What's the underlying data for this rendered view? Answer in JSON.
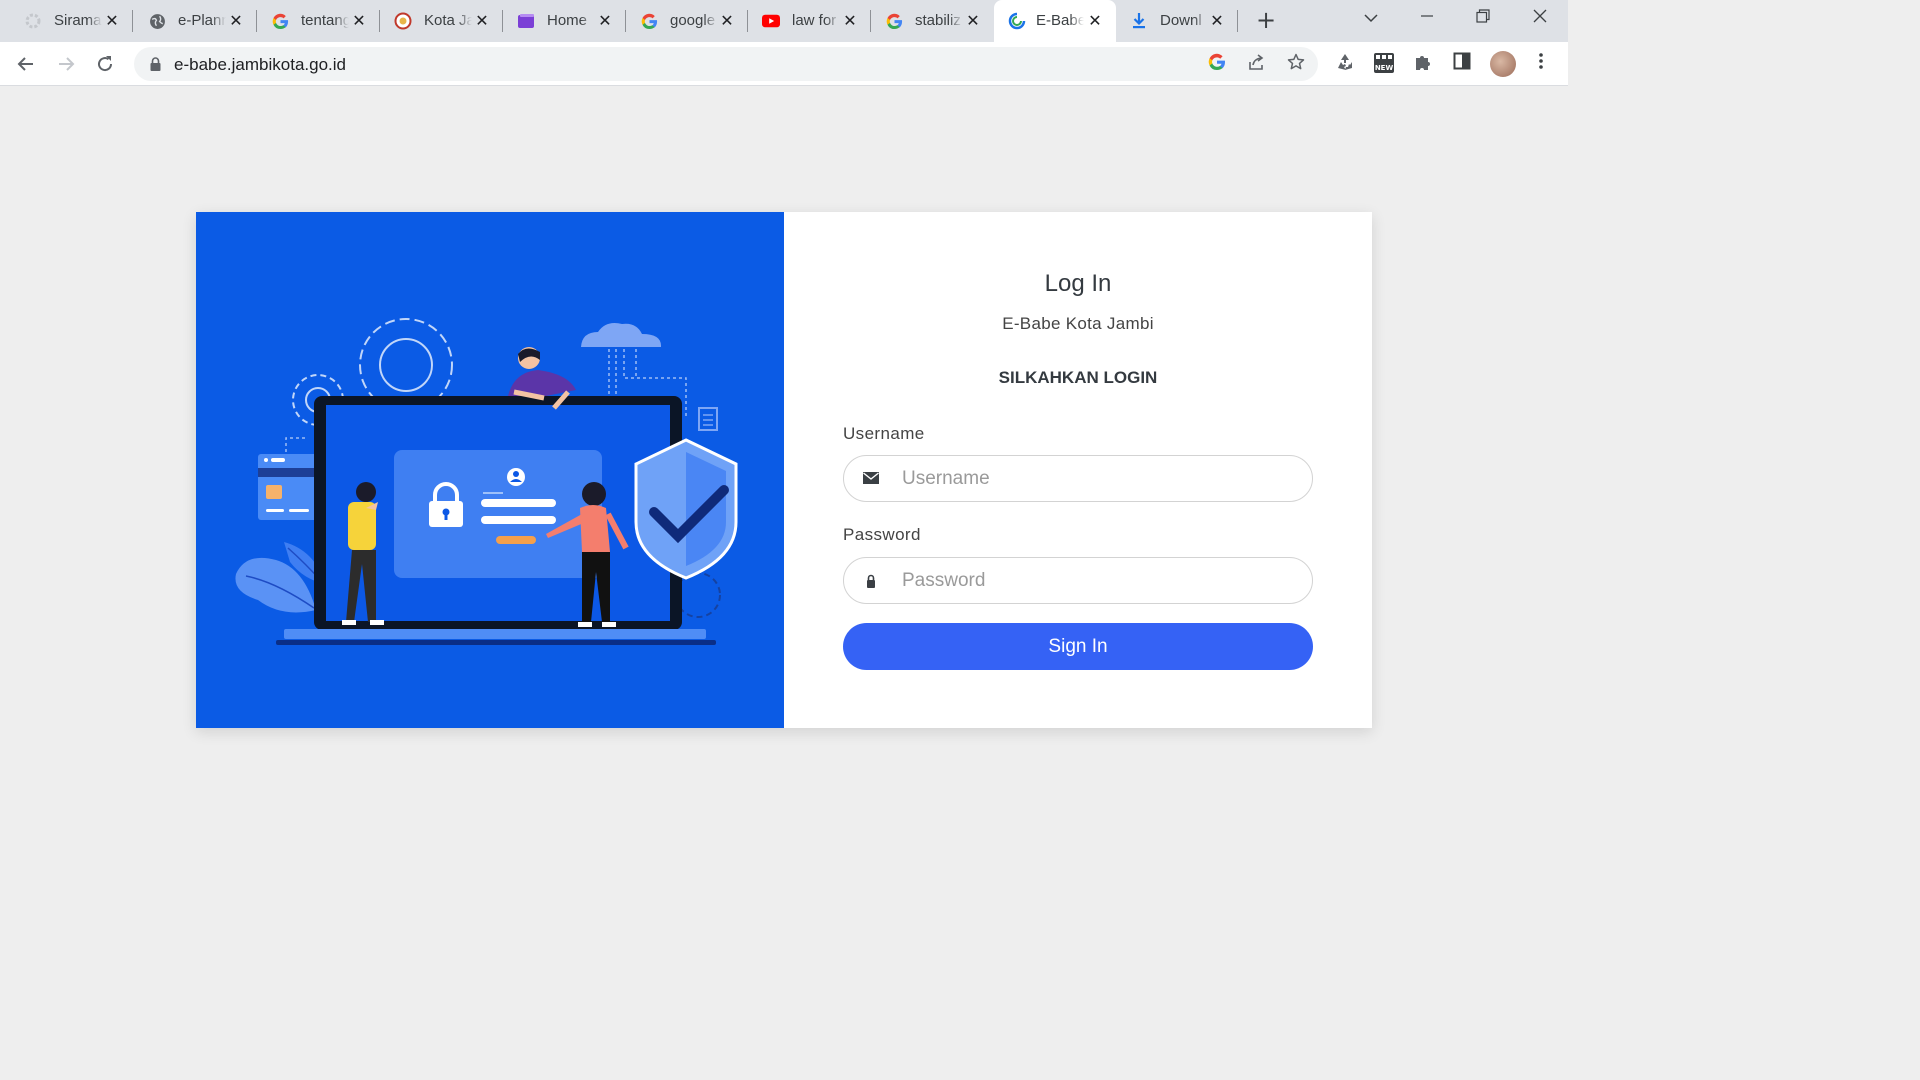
{
  "browser": {
    "tabs": [
      {
        "title": "Sirama",
        "icon": "gear-favicon-icon"
      },
      {
        "title": "e-Planning",
        "icon": "globe-favicon-icon"
      },
      {
        "title": "tentang",
        "icon": "google-favicon-icon"
      },
      {
        "title": "Kota Jambi",
        "icon": "emblem-favicon-icon"
      },
      {
        "title": "Home",
        "icon": "stack-favicon-icon"
      },
      {
        "title": "google",
        "icon": "google-favicon-icon"
      },
      {
        "title": "law for",
        "icon": "youtube-favicon-icon"
      },
      {
        "title": "stabiliz",
        "icon": "google-favicon-icon"
      },
      {
        "title": "E-Babe",
        "icon": "ebabe-favicon-icon",
        "active": true
      },
      {
        "title": "Downl",
        "icon": "download-favicon-icon"
      }
    ],
    "url": "e-babe.jambikota.go.id"
  },
  "colors": {
    "accent": "#3562f5",
    "illustration_bg": "#0b5be5"
  },
  "login": {
    "heading": "Log In",
    "subtitle": "E-Babe Kota Jambi",
    "cta": "SILKAHKAN LOGIN",
    "username_label": "Username",
    "username_placeholder": "Username",
    "password_label": "Password",
    "password_placeholder": "Password",
    "submit_label": "Sign In"
  }
}
